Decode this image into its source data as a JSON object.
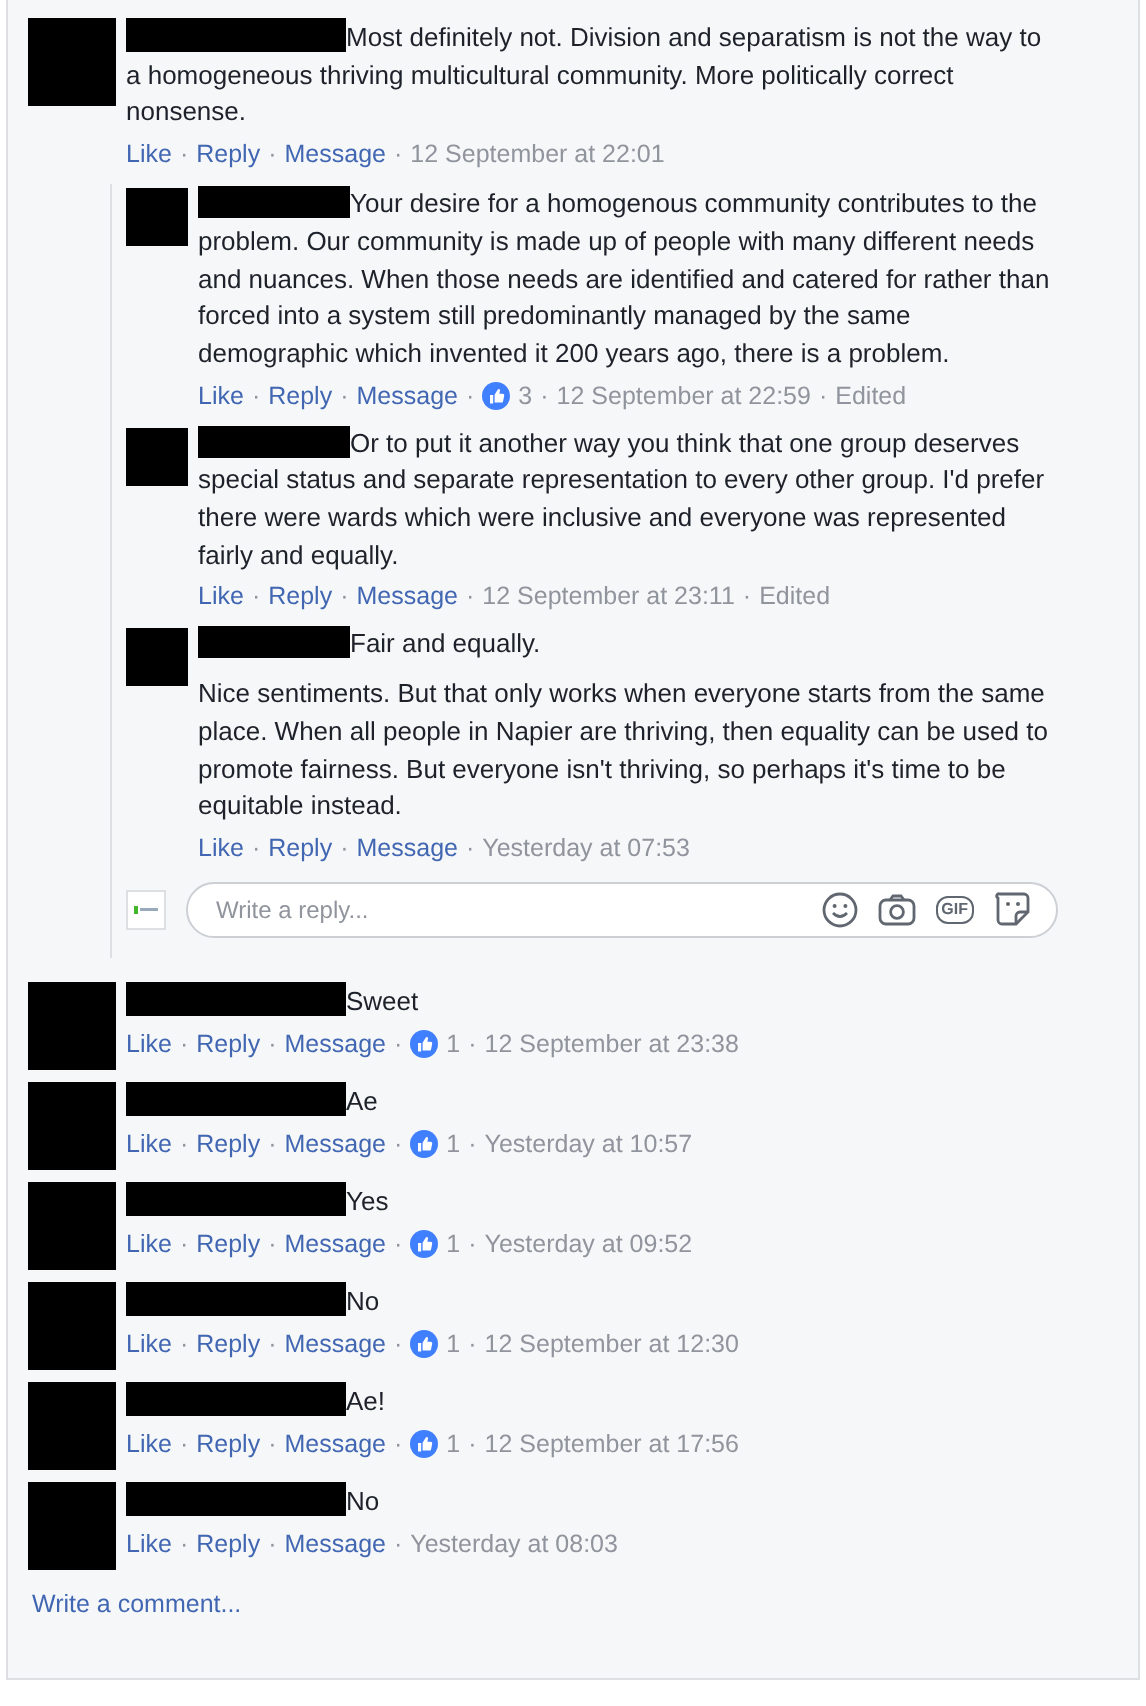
{
  "separator": "·",
  "comments": [
    {
      "text": "Most definitely not. Division and separatism is not the way to a homogeneous thriving multicultural community. More politically correct nonsense.",
      "actions": [
        "Like",
        "Reply",
        "Message"
      ],
      "time": "12 September at 22:01",
      "replies": [
        {
          "text": "Your desire for a homogenous community contributes to the problem. Our community is made up of people with many different needs and nuances. When those needs are identified and catered for rather than forced into a system still predominantly managed by the same demographic which invented it 200 years ago, there is a problem.",
          "actions": [
            "Like",
            "Reply",
            "Message"
          ],
          "likes": "3",
          "time": "12 September at 22:59",
          "edited": "Edited"
        },
        {
          "text": "Or to put it another way you think that one group deserves special status and separate representation to every other group. I'd prefer there were wards which were inclusive and everyone was represented fairly and equally.",
          "actions": [
            "Like",
            "Reply",
            "Message"
          ],
          "time": "12 September at 23:11",
          "edited": "Edited"
        },
        {
          "text": "Fair and equally.",
          "more_text": "Nice sentiments. But that only works when everyone starts from the same place. When all people in Napier are thriving, then equality can be used to promote fairness. But everyone isn't thriving, so perhaps it's time to be equitable instead.",
          "actions": [
            "Like",
            "Reply",
            "Message"
          ],
          "time": "Yesterday at 07:53"
        }
      ],
      "reply_box": {
        "placeholder": "Write a reply...",
        "gif_label": "GIF"
      }
    },
    {
      "text": "Sweet",
      "actions": [
        "Like",
        "Reply",
        "Message"
      ],
      "likes": "1",
      "time": "12 September at 23:38"
    },
    {
      "text": "Ae",
      "actions": [
        "Like",
        "Reply",
        "Message"
      ],
      "likes": "1",
      "time": "Yesterday at 10:57"
    },
    {
      "text": "Yes",
      "actions": [
        "Like",
        "Reply",
        "Message"
      ],
      "likes": "1",
      "time": "Yesterday at 09:52"
    },
    {
      "text": "No",
      "actions": [
        "Like",
        "Reply",
        "Message"
      ],
      "likes": "1",
      "time": "12 September at 12:30"
    },
    {
      "text": "Ae!",
      "actions": [
        "Like",
        "Reply",
        "Message"
      ],
      "likes": "1",
      "time": "12 September at 17:56"
    },
    {
      "text": "No",
      "actions": [
        "Like",
        "Reply",
        "Message"
      ],
      "time": "Yesterday at 08:03"
    }
  ],
  "write_comment": "Write a comment..."
}
